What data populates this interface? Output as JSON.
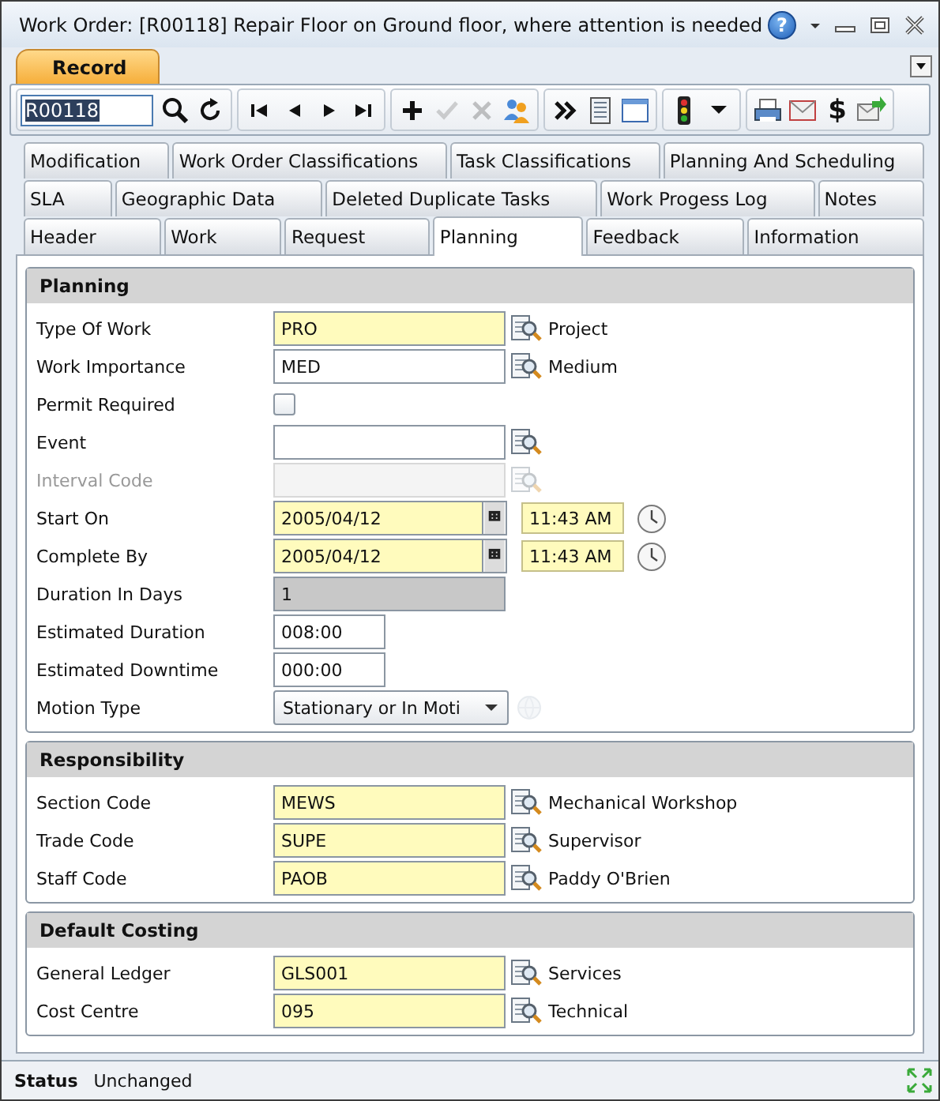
{
  "window": {
    "title": "Work Order: [R00118] Repair Floor on Ground floor, where attention is needed",
    "help_glyph": "?"
  },
  "ribbon_tabs": [
    {
      "label": "Record",
      "selected": true
    }
  ],
  "toolbar": {
    "record_field": {
      "value": "R00118"
    },
    "groups": [
      [
        {
          "kind": "search",
          "disabled": false
        },
        {
          "kind": "refresh",
          "disabled": false
        }
      ],
      [
        {
          "kind": "first",
          "disabled": false
        },
        {
          "kind": "prev",
          "disabled": false
        },
        {
          "kind": "next",
          "disabled": false
        },
        {
          "kind": "last",
          "disabled": false
        }
      ],
      [
        {
          "kind": "add",
          "disabled": false
        },
        {
          "kind": "save",
          "disabled": true
        },
        {
          "kind": "cancel",
          "disabled": true
        },
        {
          "kind": "people",
          "disabled": false
        }
      ],
      [
        {
          "kind": "more",
          "disabled": false
        },
        {
          "kind": "list",
          "disabled": false
        },
        {
          "kind": "window",
          "disabled": false
        }
      ],
      [
        {
          "kind": "traffic",
          "disabled": false
        },
        {
          "kind": "caret",
          "disabled": false
        }
      ],
      [
        {
          "kind": "print",
          "disabled": false
        },
        {
          "kind": "mail",
          "disabled": false
        },
        {
          "kind": "text",
          "text": "$",
          "disabled": false
        },
        {
          "kind": "export",
          "disabled": false
        }
      ]
    ]
  },
  "tab_rows": [
    [
      {
        "label": "Modification",
        "selected": false
      },
      {
        "label": "Work Order Classifications",
        "selected": false
      },
      {
        "label": "Task Classifications",
        "selected": false
      },
      {
        "label": "Planning And Scheduling",
        "selected": false
      }
    ],
    [
      {
        "label": "SLA",
        "selected": false
      },
      {
        "label": "Geographic Data",
        "selected": false
      },
      {
        "label": "Deleted Duplicate Tasks",
        "selected": false
      },
      {
        "label": "Work Progess Log",
        "selected": false
      },
      {
        "label": "Notes",
        "selected": false
      }
    ],
    [
      {
        "label": "Header",
        "selected": false
      },
      {
        "label": "Work",
        "selected": false
      },
      {
        "label": "Request",
        "selected": false
      },
      {
        "label": "Planning",
        "selected": true
      },
      {
        "label": "Feedback",
        "selected": false
      },
      {
        "label": "Information",
        "selected": false
      }
    ]
  ],
  "sections": [
    {
      "title": "Planning",
      "fields": [
        {
          "label": "Type Of Work",
          "kind": "lookup",
          "value": "PRO",
          "required": true,
          "description": "Project",
          "disabled": false
        },
        {
          "label": "Work Importance",
          "kind": "lookup",
          "value": "MED",
          "required": false,
          "description": "Medium",
          "disabled": false
        },
        {
          "label": "Permit Required",
          "kind": "checkbox",
          "checked": false,
          "disabled": false
        },
        {
          "label": "Event",
          "kind": "lookup",
          "required": false,
          "disabled": false
        },
        {
          "label": "Interval Code",
          "kind": "lookup",
          "required": false,
          "disabled": true
        },
        {
          "label": "Start On",
          "kind": "datetime",
          "date": "2005/04/12",
          "time": "11:43 AM",
          "required": true,
          "disabled": false
        },
        {
          "label": "Complete By",
          "kind": "datetime",
          "date": "2005/04/12",
          "time": "11:43 AM",
          "required": true,
          "disabled": false
        },
        {
          "label": "Duration In Days",
          "kind": "readonly",
          "value": "1",
          "disabled": false
        },
        {
          "label": "Estimated Duration",
          "kind": "short",
          "value": "008:00",
          "required": false,
          "disabled": false
        },
        {
          "label": "Estimated Downtime",
          "kind": "short",
          "value": "000:00",
          "required": false,
          "disabled": false
        },
        {
          "label": "Motion Type",
          "kind": "dropdown",
          "value": "Stationary or In Moti",
          "disabled": false
        }
      ]
    },
    {
      "title": "Responsibility",
      "fields": [
        {
          "label": "Section Code",
          "kind": "lookup",
          "value": "MEWS",
          "required": true,
          "description": "Mechanical Workshop"
        },
        {
          "label": "Trade Code",
          "kind": "lookup",
          "value": "SUPE",
          "required": true,
          "description": "Supervisor"
        },
        {
          "label": "Staff Code",
          "kind": "lookup",
          "value": "PAOB",
          "required": true,
          "description": "Paddy O'Brien"
        }
      ]
    },
    {
      "title": "Default Costing",
      "fields": [
        {
          "label": "General Ledger",
          "kind": "lookup",
          "value": "GLS001",
          "required": true,
          "description": "Services"
        },
        {
          "label": "Cost Centre",
          "kind": "lookup",
          "value": "095",
          "required": true,
          "description": "Technical"
        }
      ]
    }
  ],
  "status_bar": {
    "label": "Status",
    "value": "Unchanged"
  }
}
